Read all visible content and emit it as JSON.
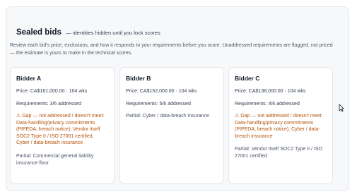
{
  "header": {
    "title": "Sealed bids",
    "subtitle": "— identities hidden until you lock scores"
  },
  "intro": "Review each bid's price, exclusions, and how it responds to your requirements before you score. Unaddressed requirements are flagged, not priced — the estimate is yours to make in the technical scores.",
  "bids": [
    {
      "name": "Bidder A",
      "price": "Price: CA$161,000.00 · 104 wks",
      "requirements": "Requirements: 3/6 addressed",
      "gap": "⚠ Gap — not addressed / doesn't meet: Data-handling/privacy commitments (PIPEDA, breach notice), Vendor itself SOC2 Type II / ISO 27001 certified, Cyber / data-breach insurance",
      "partial": "Partial: Commercial general liability insurance floor"
    },
    {
      "name": "Bidder B",
      "price": "Price: CA$152,000.00 · 104 wks",
      "requirements": "Requirements: 5/6 addressed",
      "gap": "",
      "partial": "Partial: Cyber / data-breach insurance"
    },
    {
      "name": "Bidder C",
      "price": "Price: CA$138,000.00 · 104 wks",
      "requirements": "Requirements: 4/6 addressed",
      "gap": "⚠ Gap — not addressed / doesn't meet: Data-handling/privacy commitments (PIPEDA, breach notice), Cyber / data-breach insurance",
      "partial": "Partial: Vendor itself SOC2 Type II / ISO 27001 certified"
    }
  ],
  "colors": {
    "gap_text": "#b45309",
    "panel_bg": "#f7f8fa",
    "card_bg": "#ffffff"
  }
}
